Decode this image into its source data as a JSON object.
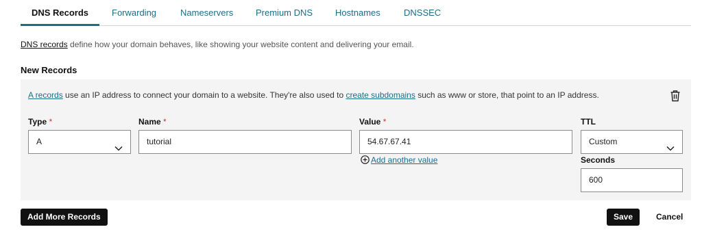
{
  "tabs": [
    "DNS Records",
    "Forwarding",
    "Nameservers",
    "Premium DNS",
    "Hostnames",
    "DNSSEC"
  ],
  "active_tab": "DNS Records",
  "intro": {
    "link_text": "DNS records",
    "text": " define how your domain behaves, like showing your website content and delivering your email."
  },
  "section_title": "New Records",
  "panel": {
    "info_link1": "A records",
    "info_text1": " use an IP address to connect your domain to a website. They're also used to ",
    "info_link2": "create subdomains",
    "info_text2": " such as www or store, that point to an IP address.",
    "trash_icon": "trash-icon"
  },
  "form": {
    "type_label": "Type",
    "name_label": "Name",
    "value_label": "Value",
    "ttl_label": "TTL",
    "required_mark": "*",
    "type_value": "A",
    "name_value": "tutorial",
    "value_value": "54.67.67.41",
    "ttl_value": "Custom",
    "add_value_link": "Add another value",
    "seconds_label": "Seconds",
    "seconds_value": "600"
  },
  "buttons": {
    "add_more": "Add More Records",
    "save": "Save",
    "cancel": "Cancel"
  },
  "colors": {
    "accent": "#1b6e86",
    "required": "#d0312d",
    "button_dark": "#111111",
    "panel_bg": "#f4f4f4"
  }
}
